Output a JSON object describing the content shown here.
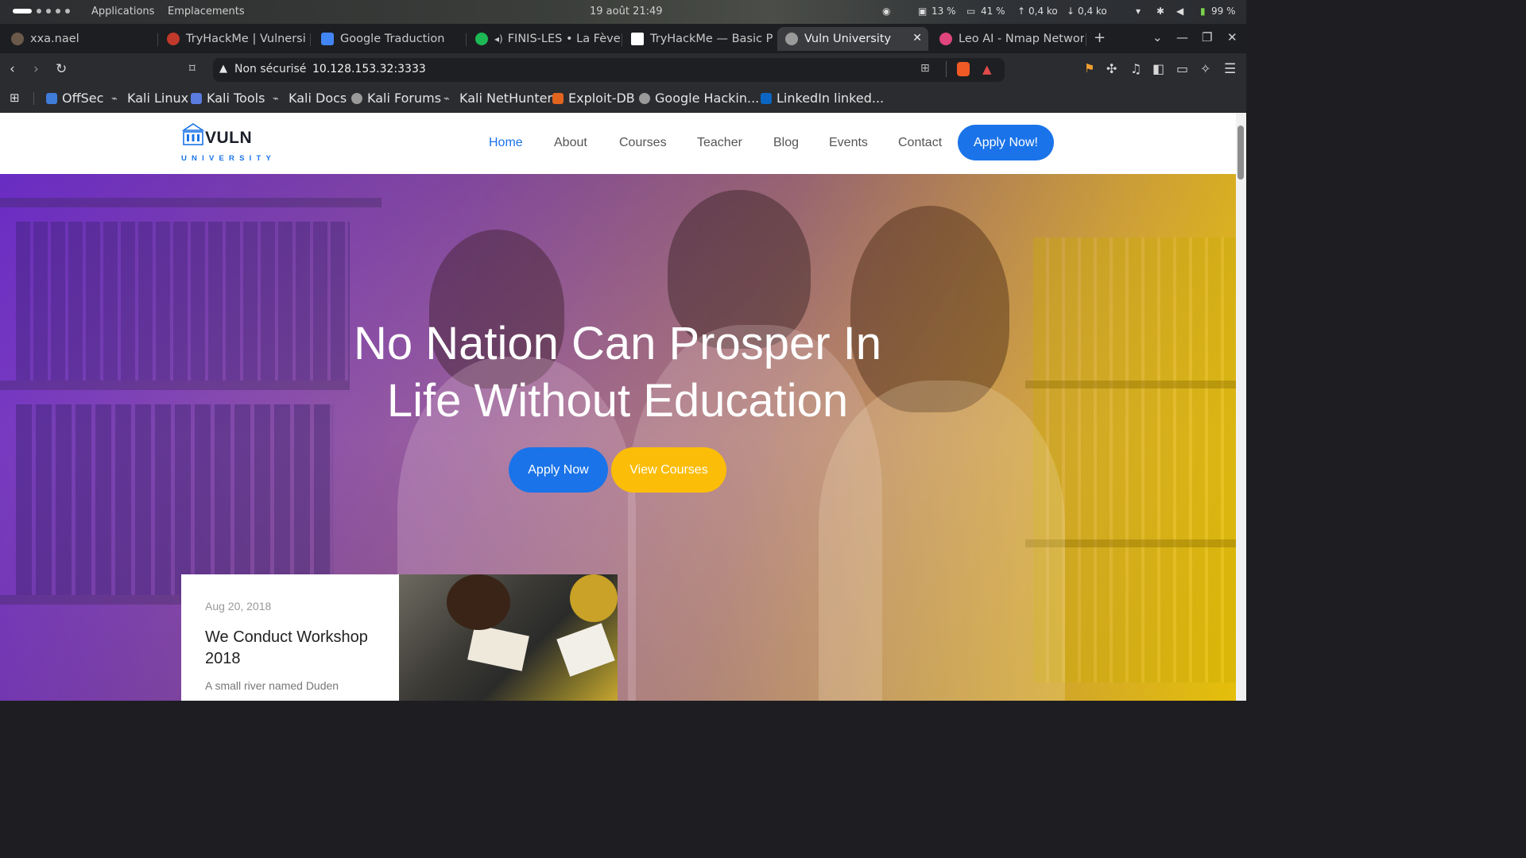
{
  "os": {
    "menu_apps": "Applications",
    "menu_places": "Emplacements",
    "clock": "19 août  21:49",
    "cpu": "13 %",
    "mem": "41 %",
    "up": "0,4 ko",
    "down": "0,4 ko",
    "battery": "99 %"
  },
  "tabs": [
    {
      "label": "xxa.nael",
      "icon_color": "#6b5a4a"
    },
    {
      "label": "TryHackMe | Vulnersi",
      "icon_color": "#c0392b"
    },
    {
      "label": "Google Traduction",
      "icon_color": "#4285f4"
    },
    {
      "label": "FINIS-LES • La Fève",
      "icon_color": "#1db954"
    },
    {
      "label": "TryHackMe — Basic P",
      "icon_color": "#ffffff"
    },
    {
      "label": "Vuln University",
      "icon_color": "#9a9a9a"
    },
    {
      "label": "Leo AI - Nmap Networ",
      "icon_color": "#e0457b"
    }
  ],
  "address": {
    "security": "Non sécurisé",
    "url": "10.128.153.32:3333"
  },
  "bookmarks": [
    {
      "label": "OffSec",
      "color": "#3f7bd8"
    },
    {
      "label": "Kali Linux",
      "color": "#cfcfcf"
    },
    {
      "label": "Kali Tools",
      "color": "#5a7be0"
    },
    {
      "label": "Kali Docs",
      "color": "#cfcfcf"
    },
    {
      "label": "Kali Forums",
      "color": "#cfcfcf"
    },
    {
      "label": "Kali NetHunter",
      "color": "#cfcfcf"
    },
    {
      "label": "Exploit-DB",
      "color": "#e0641e"
    },
    {
      "label": "Google Hackin...",
      "color": "#cfcfcf"
    },
    {
      "label": "LinkedIn linked...",
      "color": "#0a66c2"
    }
  ],
  "site": {
    "logo_main": "VULN",
    "logo_sub": "UNIVERSITY",
    "nav": [
      "Home",
      "About",
      "Courses",
      "Teacher",
      "Blog",
      "Events",
      "Contact"
    ],
    "apply_label": "Apply Now!",
    "accent": "#1a73e8",
    "yellow": "#fbbd08"
  },
  "hero": {
    "title_line1": "No Nation Can Prosper In",
    "title_line2": "Life Without Education",
    "btn_apply": "Apply Now",
    "btn_courses": "View Courses"
  },
  "card": {
    "date": "Aug 20, 2018",
    "title": "We Conduct Workshop 2018",
    "text": "A small river named Duden"
  }
}
